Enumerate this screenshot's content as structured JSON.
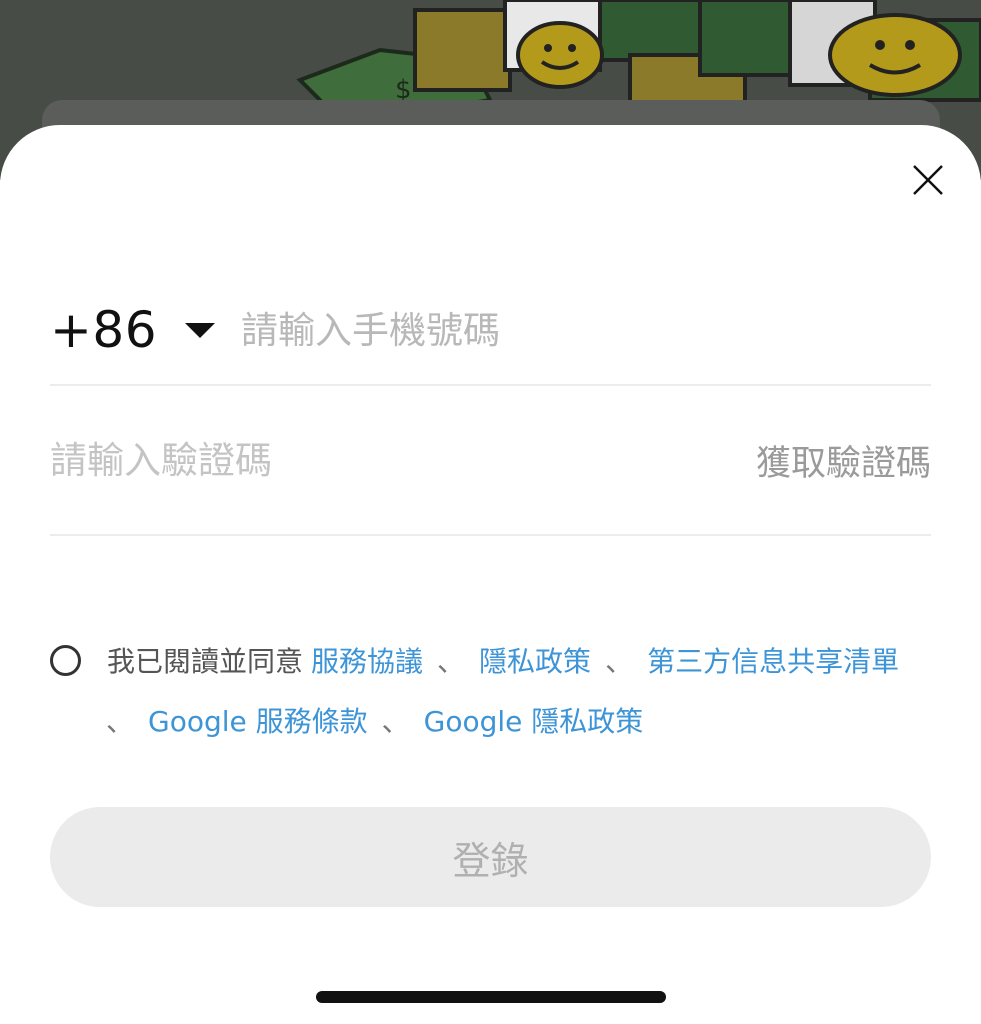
{
  "phone": {
    "country_code": "+86",
    "placeholder": "請輸入手機號碼"
  },
  "verification": {
    "placeholder": "請輸入驗證碼",
    "get_code_label": "獲取驗證碼"
  },
  "agreement": {
    "prefix": "我已閱讀並同意",
    "separator": "、",
    "links": [
      "服務協議",
      "隱私政策",
      "第三方信息共享清單",
      "Google 服務條款",
      "Google 隱私政策"
    ]
  },
  "login": {
    "label": "登錄"
  },
  "icons": {
    "close": "close-icon",
    "dropdown": "caret-down-icon",
    "checkbox": "radio-unchecked-icon"
  },
  "colors": {
    "link": "#3d94d6",
    "button_bg": "#ebebeb",
    "button_text": "#b0b0b0",
    "placeholder": "#b8b8b8"
  }
}
